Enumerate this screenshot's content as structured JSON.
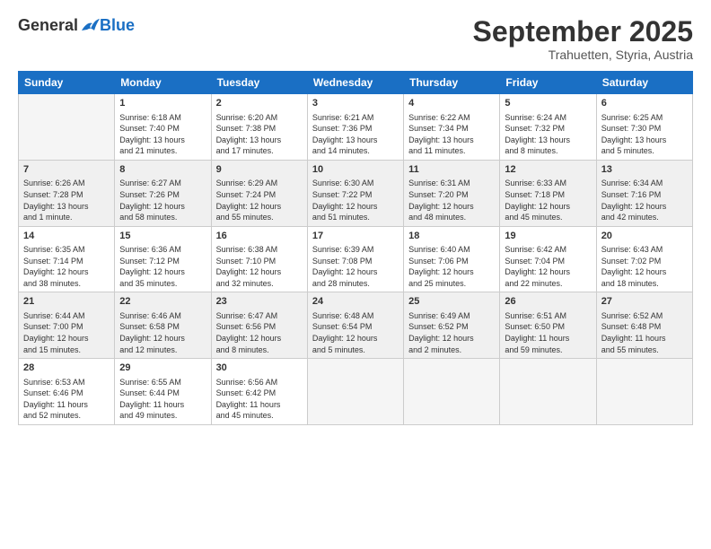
{
  "header": {
    "logo": {
      "general": "General",
      "blue": "Blue"
    },
    "title": "September 2025",
    "location": "Trahuetten, Styria, Austria"
  },
  "calendar": {
    "headers": [
      "Sunday",
      "Monday",
      "Tuesday",
      "Wednesday",
      "Thursday",
      "Friday",
      "Saturday"
    ],
    "weeks": [
      {
        "shade": "light",
        "days": [
          {
            "num": "",
            "info": ""
          },
          {
            "num": "1",
            "info": "Sunrise: 6:18 AM\nSunset: 7:40 PM\nDaylight: 13 hours\nand 21 minutes."
          },
          {
            "num": "2",
            "info": "Sunrise: 6:20 AM\nSunset: 7:38 PM\nDaylight: 13 hours\nand 17 minutes."
          },
          {
            "num": "3",
            "info": "Sunrise: 6:21 AM\nSunset: 7:36 PM\nDaylight: 13 hours\nand 14 minutes."
          },
          {
            "num": "4",
            "info": "Sunrise: 6:22 AM\nSunset: 7:34 PM\nDaylight: 13 hours\nand 11 minutes."
          },
          {
            "num": "5",
            "info": "Sunrise: 6:24 AM\nSunset: 7:32 PM\nDaylight: 13 hours\nand 8 minutes."
          },
          {
            "num": "6",
            "info": "Sunrise: 6:25 AM\nSunset: 7:30 PM\nDaylight: 13 hours\nand 5 minutes."
          }
        ]
      },
      {
        "shade": "gray",
        "days": [
          {
            "num": "7",
            "info": "Sunrise: 6:26 AM\nSunset: 7:28 PM\nDaylight: 13 hours\nand 1 minute."
          },
          {
            "num": "8",
            "info": "Sunrise: 6:27 AM\nSunset: 7:26 PM\nDaylight: 12 hours\nand 58 minutes."
          },
          {
            "num": "9",
            "info": "Sunrise: 6:29 AM\nSunset: 7:24 PM\nDaylight: 12 hours\nand 55 minutes."
          },
          {
            "num": "10",
            "info": "Sunrise: 6:30 AM\nSunset: 7:22 PM\nDaylight: 12 hours\nand 51 minutes."
          },
          {
            "num": "11",
            "info": "Sunrise: 6:31 AM\nSunset: 7:20 PM\nDaylight: 12 hours\nand 48 minutes."
          },
          {
            "num": "12",
            "info": "Sunrise: 6:33 AM\nSunset: 7:18 PM\nDaylight: 12 hours\nand 45 minutes."
          },
          {
            "num": "13",
            "info": "Sunrise: 6:34 AM\nSunset: 7:16 PM\nDaylight: 12 hours\nand 42 minutes."
          }
        ]
      },
      {
        "shade": "light",
        "days": [
          {
            "num": "14",
            "info": "Sunrise: 6:35 AM\nSunset: 7:14 PM\nDaylight: 12 hours\nand 38 minutes."
          },
          {
            "num": "15",
            "info": "Sunrise: 6:36 AM\nSunset: 7:12 PM\nDaylight: 12 hours\nand 35 minutes."
          },
          {
            "num": "16",
            "info": "Sunrise: 6:38 AM\nSunset: 7:10 PM\nDaylight: 12 hours\nand 32 minutes."
          },
          {
            "num": "17",
            "info": "Sunrise: 6:39 AM\nSunset: 7:08 PM\nDaylight: 12 hours\nand 28 minutes."
          },
          {
            "num": "18",
            "info": "Sunrise: 6:40 AM\nSunset: 7:06 PM\nDaylight: 12 hours\nand 25 minutes."
          },
          {
            "num": "19",
            "info": "Sunrise: 6:42 AM\nSunset: 7:04 PM\nDaylight: 12 hours\nand 22 minutes."
          },
          {
            "num": "20",
            "info": "Sunrise: 6:43 AM\nSunset: 7:02 PM\nDaylight: 12 hours\nand 18 minutes."
          }
        ]
      },
      {
        "shade": "gray",
        "days": [
          {
            "num": "21",
            "info": "Sunrise: 6:44 AM\nSunset: 7:00 PM\nDaylight: 12 hours\nand 15 minutes."
          },
          {
            "num": "22",
            "info": "Sunrise: 6:46 AM\nSunset: 6:58 PM\nDaylight: 12 hours\nand 12 minutes."
          },
          {
            "num": "23",
            "info": "Sunrise: 6:47 AM\nSunset: 6:56 PM\nDaylight: 12 hours\nand 8 minutes."
          },
          {
            "num": "24",
            "info": "Sunrise: 6:48 AM\nSunset: 6:54 PM\nDaylight: 12 hours\nand 5 minutes."
          },
          {
            "num": "25",
            "info": "Sunrise: 6:49 AM\nSunset: 6:52 PM\nDaylight: 12 hours\nand 2 minutes."
          },
          {
            "num": "26",
            "info": "Sunrise: 6:51 AM\nSunset: 6:50 PM\nDaylight: 11 hours\nand 59 minutes."
          },
          {
            "num": "27",
            "info": "Sunrise: 6:52 AM\nSunset: 6:48 PM\nDaylight: 11 hours\nand 55 minutes."
          }
        ]
      },
      {
        "shade": "light",
        "days": [
          {
            "num": "28",
            "info": "Sunrise: 6:53 AM\nSunset: 6:46 PM\nDaylight: 11 hours\nand 52 minutes."
          },
          {
            "num": "29",
            "info": "Sunrise: 6:55 AM\nSunset: 6:44 PM\nDaylight: 11 hours\nand 49 minutes."
          },
          {
            "num": "30",
            "info": "Sunrise: 6:56 AM\nSunset: 6:42 PM\nDaylight: 11 hours\nand 45 minutes."
          },
          {
            "num": "",
            "info": ""
          },
          {
            "num": "",
            "info": ""
          },
          {
            "num": "",
            "info": ""
          },
          {
            "num": "",
            "info": ""
          }
        ]
      }
    ]
  }
}
